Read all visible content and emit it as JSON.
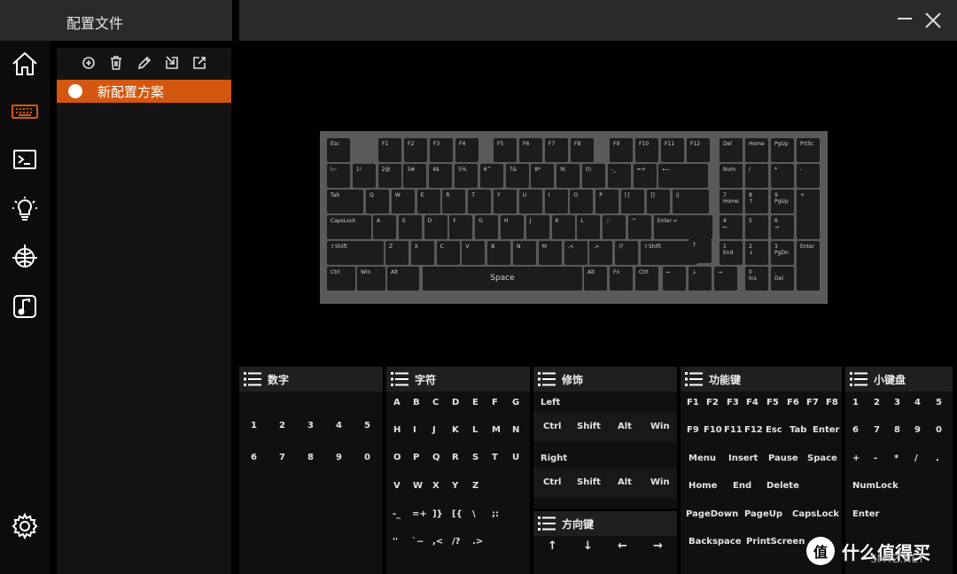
{
  "app": {
    "title": "配置文件"
  },
  "rail": [
    "home-icon",
    "keyboard-icon",
    "terminal-icon",
    "lightbulb-icon",
    "globe-icon",
    "music-note-icon",
    "gear-icon"
  ],
  "profiles": [
    {
      "name": "新配置方案",
      "active": true
    }
  ],
  "colors": {
    "accent": "#d4570f",
    "panel": "#141414",
    "header": "#2a2a2a",
    "keyboard_frame": "#5a5a5a"
  },
  "keyboard": {
    "rows": [
      [
        "Esc",
        "F1",
        "F2",
        "F3",
        "F4",
        "F5",
        "F6",
        "F7",
        "F8",
        "F9",
        "F10",
        "F11",
        "F12",
        "Del",
        "Home",
        "PgUp",
        "PrtSc"
      ],
      [
        "\\~",
        "1!",
        "2@",
        "3#",
        "4$",
        "5%",
        "6^",
        "7&",
        "8*",
        "9(",
        "0)",
        "-_",
        "=+",
        "⟵",
        "Num",
        "/",
        "*",
        "-"
      ],
      [
        "Tab",
        "Q",
        "W",
        "E",
        "R",
        "T",
        "Y",
        "U",
        "I",
        "O",
        "P",
        "[{",
        "]}",
        "\\|",
        "7\nHome",
        "8\n↑",
        "9\nPgUp",
        "+"
      ],
      [
        "CapsLock",
        "A",
        "S",
        "D",
        "F",
        "G",
        "H",
        "J",
        "K",
        "L",
        ";:",
        "'\"",
        "Enter ↵",
        "4\n←",
        "5",
        "6\n→"
      ],
      [
        "⇧Shift",
        "Z",
        "X",
        "C",
        "V",
        "B",
        "N",
        "M",
        ",<",
        ".>",
        "/?",
        "⇧Shift",
        "↑",
        "1\nEnd",
        "2\n↓",
        "3\nPgDn",
        "Enter"
      ],
      [
        "Ctrl",
        "Win",
        "Alt",
        "Space",
        "Alt",
        "Fn",
        "Ctrl",
        "←",
        "↓",
        "→",
        "0\nIns",
        ".\nDel"
      ]
    ]
  },
  "panels": {
    "numbers": {
      "title": "数字",
      "keys": [
        "1",
        "2",
        "3",
        "4",
        "5",
        "6",
        "7",
        "8",
        "9",
        "0"
      ]
    },
    "chars": {
      "title": "字符",
      "keys": [
        "A",
        "B",
        "C",
        "D",
        "E",
        "F",
        "G",
        "H",
        "I",
        "J",
        "K",
        "L",
        "M",
        "N",
        "O",
        "P",
        "Q",
        "R",
        "S",
        "T",
        "U",
        "V",
        "W",
        "X",
        "Y",
        "Z",
        "-_",
        "=+",
        "]}",
        "[{",
        "\\",
        ";:",
        "''",
        "`~",
        ",<",
        "/?",
        ".>"
      ]
    },
    "modifiers": {
      "title": "修饰",
      "left_label": "Left",
      "right_label": "Right",
      "keys": [
        "Ctrl",
        "Shift",
        "Alt",
        "Win"
      ]
    },
    "arrows": {
      "title": "方向键",
      "keys": [
        "↑",
        "↓",
        "←",
        "→"
      ]
    },
    "functions": {
      "title": "功能键",
      "keys": [
        "F1",
        "F2",
        "F3",
        "F4",
        "F5",
        "F6",
        "F7",
        "F8",
        "F9",
        "F10",
        "F11",
        "F12",
        "Esc",
        "Tab",
        "Enter",
        "Menu",
        "Insert",
        "Pause",
        "Space",
        "Home",
        "End",
        "Delete",
        "PageDown",
        "PageUp",
        "CapsLock",
        "Backspace",
        "PrintScreen"
      ]
    },
    "numpad": {
      "title": "小键盘",
      "keys": [
        "1",
        "2",
        "3",
        "4",
        "5",
        "6",
        "7",
        "8",
        "9",
        "0",
        "+",
        "-",
        "*",
        "/",
        ".",
        "NumLock",
        "Enter"
      ]
    }
  },
  "watermark": {
    "text": "什么值得买",
    "site": "SMYZ.NET",
    "logo_glyph": "值"
  }
}
